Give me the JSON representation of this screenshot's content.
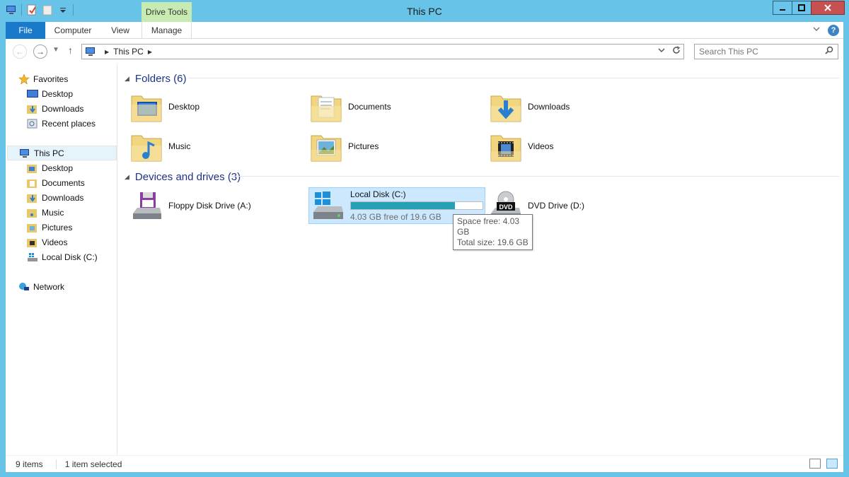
{
  "window": {
    "title": "This PC",
    "contextual_tab": "Drive Tools"
  },
  "ribbon": {
    "tabs": [
      {
        "label": "File"
      },
      {
        "label": "Computer"
      },
      {
        "label": "View"
      },
      {
        "label": "Manage"
      }
    ]
  },
  "address": {
    "crumb": "This PC",
    "search_placeholder": "Search This PC"
  },
  "navpane": {
    "favorites": {
      "label": "Favorites",
      "items": [
        "Desktop",
        "Downloads",
        "Recent places"
      ]
    },
    "this_pc": {
      "label": "This PC",
      "items": [
        "Desktop",
        "Documents",
        "Downloads",
        "Music",
        "Pictures",
        "Videos",
        "Local Disk (C:)"
      ]
    },
    "network": {
      "label": "Network"
    }
  },
  "folders": {
    "header": "Folders (6)",
    "items": [
      "Desktop",
      "Documents",
      "Downloads",
      "Music",
      "Pictures",
      "Videos"
    ]
  },
  "devices": {
    "header": "Devices and drives (3)",
    "floppy": {
      "label": "Floppy Disk Drive (A:)"
    },
    "local_disk": {
      "label": "Local Disk (C:)",
      "free_text": "4.03 GB free of 19.6 GB",
      "used_fraction": 0.79
    },
    "dvd": {
      "label": "DVD Drive (D:)",
      "badge": "DVD"
    }
  },
  "tooltip": {
    "line1": "Space free: 4.03 GB",
    "line2": "Total size: 19.6 GB"
  },
  "status": {
    "count": "9 items",
    "selected": "1 item selected"
  },
  "colors": {
    "accent": "#1979ca",
    "drive_bar": "#26a0b5",
    "selection": "#cce8ff"
  }
}
